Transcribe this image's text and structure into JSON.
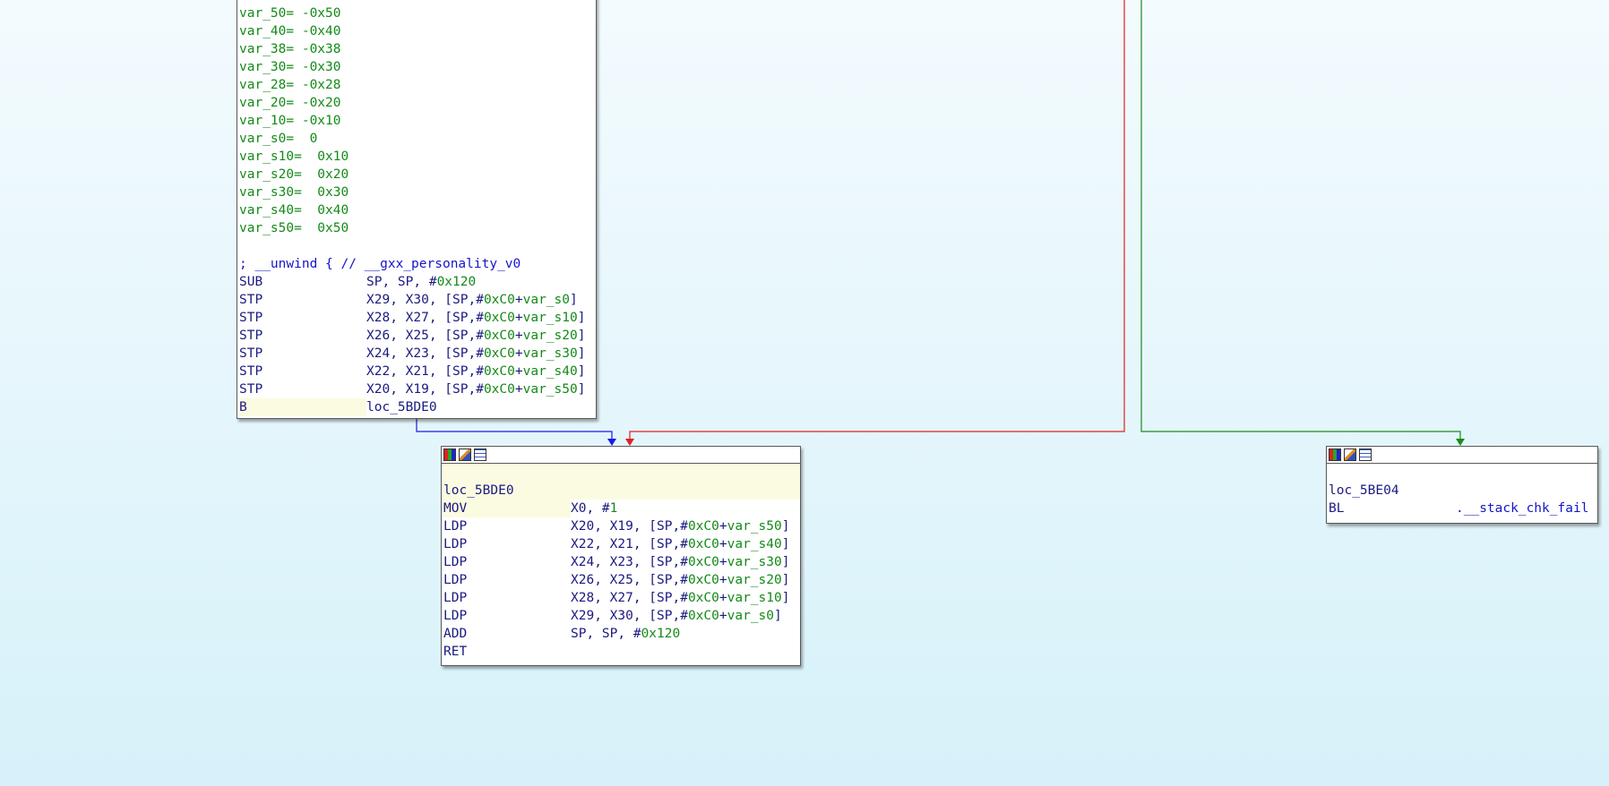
{
  "block_top": {
    "vars": [
      {
        "name": "var_50=",
        "value": " -0x50"
      },
      {
        "name": "var_40=",
        "value": " -0x40"
      },
      {
        "name": "var_38=",
        "value": " -0x38"
      },
      {
        "name": "var_30=",
        "value": " -0x30"
      },
      {
        "name": "var_28=",
        "value": " -0x28"
      },
      {
        "name": "var_20=",
        "value": " -0x20"
      },
      {
        "name": "var_10=",
        "value": " -0x10"
      },
      {
        "name": "var_s0=",
        "value": "  0"
      },
      {
        "name": "var_s10=",
        "value": "  0x10"
      },
      {
        "name": "var_s20=",
        "value": "  0x20"
      },
      {
        "name": "var_s30=",
        "value": "  0x30"
      },
      {
        "name": "var_s40=",
        "value": "  0x40"
      },
      {
        "name": "var_s50=",
        "value": "  0x50"
      }
    ],
    "unwind_comment": "; __unwind { // __gxx_personality_v0",
    "instructions": [
      {
        "mnem": "SUB",
        "ops": [
          {
            "t": "SP, SP, #",
            "c": "navy"
          },
          {
            "t": "0x120",
            "c": "green"
          }
        ]
      },
      {
        "mnem": "STP",
        "ops": [
          {
            "t": "X29, X30, [SP,#",
            "c": "navy"
          },
          {
            "t": "0xC0",
            "c": "green"
          },
          {
            "t": "+",
            "c": "navy"
          },
          {
            "t": "var_s0",
            "c": "green"
          },
          {
            "t": "]",
            "c": "navy"
          }
        ]
      },
      {
        "mnem": "STP",
        "ops": [
          {
            "t": "X28, X27, [SP,#",
            "c": "navy"
          },
          {
            "t": "0xC0",
            "c": "green"
          },
          {
            "t": "+",
            "c": "navy"
          },
          {
            "t": "var_s10",
            "c": "green"
          },
          {
            "t": "]",
            "c": "navy"
          }
        ]
      },
      {
        "mnem": "STP",
        "ops": [
          {
            "t": "X26, X25, [SP,#",
            "c": "navy"
          },
          {
            "t": "0xC0",
            "c": "green"
          },
          {
            "t": "+",
            "c": "navy"
          },
          {
            "t": "var_s20",
            "c": "green"
          },
          {
            "t": "]",
            "c": "navy"
          }
        ]
      },
      {
        "mnem": "STP",
        "ops": [
          {
            "t": "X24, X23, [SP,#",
            "c": "navy"
          },
          {
            "t": "0xC0",
            "c": "green"
          },
          {
            "t": "+",
            "c": "navy"
          },
          {
            "t": "var_s30",
            "c": "green"
          },
          {
            "t": "]",
            "c": "navy"
          }
        ]
      },
      {
        "mnem": "STP",
        "ops": [
          {
            "t": "X22, X21, [SP,#",
            "c": "navy"
          },
          {
            "t": "0xC0",
            "c": "green"
          },
          {
            "t": "+",
            "c": "navy"
          },
          {
            "t": "var_s40",
            "c": "green"
          },
          {
            "t": "]",
            "c": "navy"
          }
        ]
      },
      {
        "mnem": "STP",
        "ops": [
          {
            "t": "X20, X19, [SP,#",
            "c": "navy"
          },
          {
            "t": "0xC0",
            "c": "green"
          },
          {
            "t": "+",
            "c": "navy"
          },
          {
            "t": "var_s50",
            "c": "green"
          },
          {
            "t": "]",
            "c": "navy"
          }
        ]
      },
      {
        "mnem": "B",
        "highlight": true,
        "ops": [
          {
            "t": "loc_5BDE0",
            "c": "navy"
          }
        ]
      }
    ]
  },
  "block_loc_5BDE0": {
    "label": "loc_5BDE0",
    "instructions": [
      {
        "mnem": "MOV",
        "highlight": true,
        "ops": [
          {
            "t": "X0, #",
            "c": "navy"
          },
          {
            "t": "1",
            "c": "green"
          }
        ]
      },
      {
        "mnem": "LDP",
        "ops": [
          {
            "t": "X20, X19, [SP,#",
            "c": "navy"
          },
          {
            "t": "0xC0",
            "c": "green"
          },
          {
            "t": "+",
            "c": "navy"
          },
          {
            "t": "var_s50",
            "c": "green"
          },
          {
            "t": "]",
            "c": "navy"
          }
        ]
      },
      {
        "mnem": "LDP",
        "ops": [
          {
            "t": "X22, X21, [SP,#",
            "c": "navy"
          },
          {
            "t": "0xC0",
            "c": "green"
          },
          {
            "t": "+",
            "c": "navy"
          },
          {
            "t": "var_s40",
            "c": "green"
          },
          {
            "t": "]",
            "c": "navy"
          }
        ]
      },
      {
        "mnem": "LDP",
        "ops": [
          {
            "t": "X24, X23, [SP,#",
            "c": "navy"
          },
          {
            "t": "0xC0",
            "c": "green"
          },
          {
            "t": "+",
            "c": "navy"
          },
          {
            "t": "var_s30",
            "c": "green"
          },
          {
            "t": "]",
            "c": "navy"
          }
        ]
      },
      {
        "mnem": "LDP",
        "ops": [
          {
            "t": "X26, X25, [SP,#",
            "c": "navy"
          },
          {
            "t": "0xC0",
            "c": "green"
          },
          {
            "t": "+",
            "c": "navy"
          },
          {
            "t": "var_s20",
            "c": "green"
          },
          {
            "t": "]",
            "c": "navy"
          }
        ]
      },
      {
        "mnem": "LDP",
        "ops": [
          {
            "t": "X28, X27, [SP,#",
            "c": "navy"
          },
          {
            "t": "0xC0",
            "c": "green"
          },
          {
            "t": "+",
            "c": "navy"
          },
          {
            "t": "var_s10",
            "c": "green"
          },
          {
            "t": "]",
            "c": "navy"
          }
        ]
      },
      {
        "mnem": "LDP",
        "ops": [
          {
            "t": "X29, X30, [SP,#",
            "c": "navy"
          },
          {
            "t": "0xC0",
            "c": "green"
          },
          {
            "t": "+",
            "c": "navy"
          },
          {
            "t": "var_s0",
            "c": "green"
          },
          {
            "t": "]",
            "c": "navy"
          }
        ]
      },
      {
        "mnem": "ADD",
        "ops": [
          {
            "t": "SP, SP, #",
            "c": "navy"
          },
          {
            "t": "0x120",
            "c": "green"
          }
        ]
      },
      {
        "mnem": "RET",
        "ops": []
      }
    ]
  },
  "block_loc_5BE04": {
    "label": "loc_5BE04",
    "instructions": [
      {
        "mnem": "BL",
        "ops": [
          {
            "t": ".__stack_chk_fail",
            "c": "blue"
          }
        ]
      }
    ]
  },
  "header_icons": [
    "color-palette-icon",
    "edit-pencil-icon",
    "graph-overview-icon"
  ],
  "colors": {
    "edge_unconditional": "#1a1ae6",
    "edge_false": "#e02020",
    "edge_true": "#1a8c1a",
    "operand_number": "#138a17",
    "operand_text": "#1a1a80",
    "highlight": "#fbfbe1"
  }
}
